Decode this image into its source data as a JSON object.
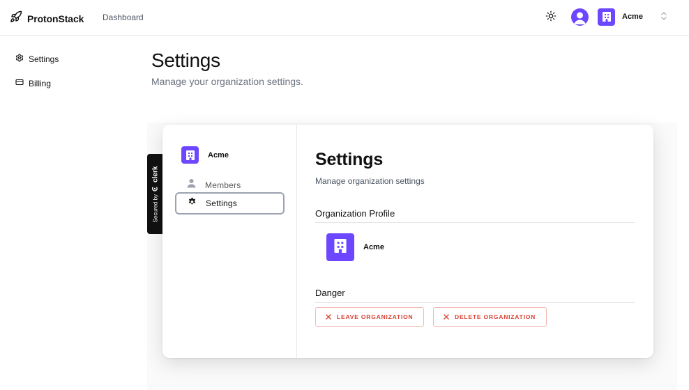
{
  "topbar": {
    "brand": "ProtonStack",
    "nav_dashboard": "Dashboard",
    "org_name": "Acme"
  },
  "sidenav": {
    "items": [
      {
        "label": "Settings",
        "icon": "gear-icon"
      },
      {
        "label": "Billing",
        "icon": "credit-card-icon"
      }
    ]
  },
  "page": {
    "title": "Settings",
    "subtitle": "Manage your organization settings."
  },
  "card": {
    "org_name": "Acme",
    "nav": {
      "members": "Members",
      "settings": "Settings"
    },
    "title": "Settings",
    "subtitle": "Manage organization settings",
    "profile_section": "Organization Profile",
    "profile_name": "Acme",
    "danger_section": "Danger",
    "leave_label": "LEAVE ORGANIZATION",
    "delete_label": "DELETE ORGANIZATION"
  },
  "secured": {
    "text": "Secured by",
    "brand": "clerk"
  },
  "colors": {
    "accent": "#6c47ff",
    "danger": "#d94133",
    "danger_border": "#f3b8b2",
    "muted_text": "#6b7280"
  }
}
